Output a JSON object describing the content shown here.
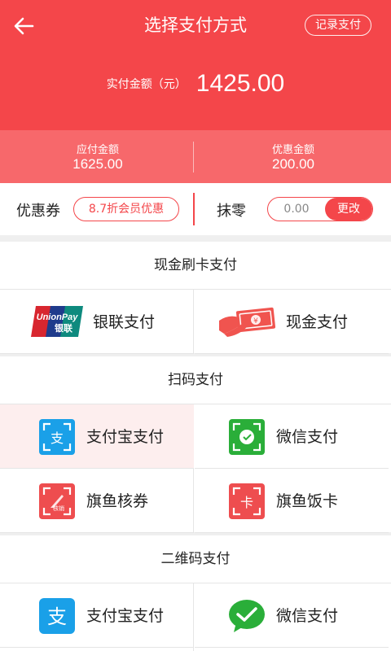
{
  "header": {
    "title": "选择支付方式",
    "record_button": "记录支付",
    "paid_label": "实付金额（元）",
    "paid_amount": "1425.00"
  },
  "summary": {
    "payable_label": "应付金额",
    "payable_value": "1625.00",
    "discount_label": "优惠金额",
    "discount_value": "200.00"
  },
  "discounts": {
    "coupon_label": "优惠券",
    "coupon_value": "8.7折会员优惠",
    "round_label": "抹零",
    "round_value": "0.00",
    "round_button": "更改"
  },
  "sections": {
    "cash_card": {
      "title": "现金刷卡支付",
      "unionpay": "银联支付",
      "cash": "现金支付"
    },
    "scan": {
      "title": "扫码支付",
      "alipay": "支付宝支付",
      "wechat": "微信支付",
      "coupon_verify": "旗鱼核券",
      "meal_card": "旗鱼饭卡"
    },
    "qrcode": {
      "title": "二维码支付",
      "alipay": "支付宝支付",
      "wechat": "微信支付"
    }
  },
  "icons": {
    "unionpay_text": "UnionPay",
    "unionpay_cn": "银联",
    "alipay_glyph": "支",
    "card_glyph": "卡",
    "coupon_glyph": "核销"
  },
  "colors": {
    "brand_red": "#f4464a",
    "alipay_blue": "#1aa0e8",
    "wechat_green": "#2aae39"
  }
}
